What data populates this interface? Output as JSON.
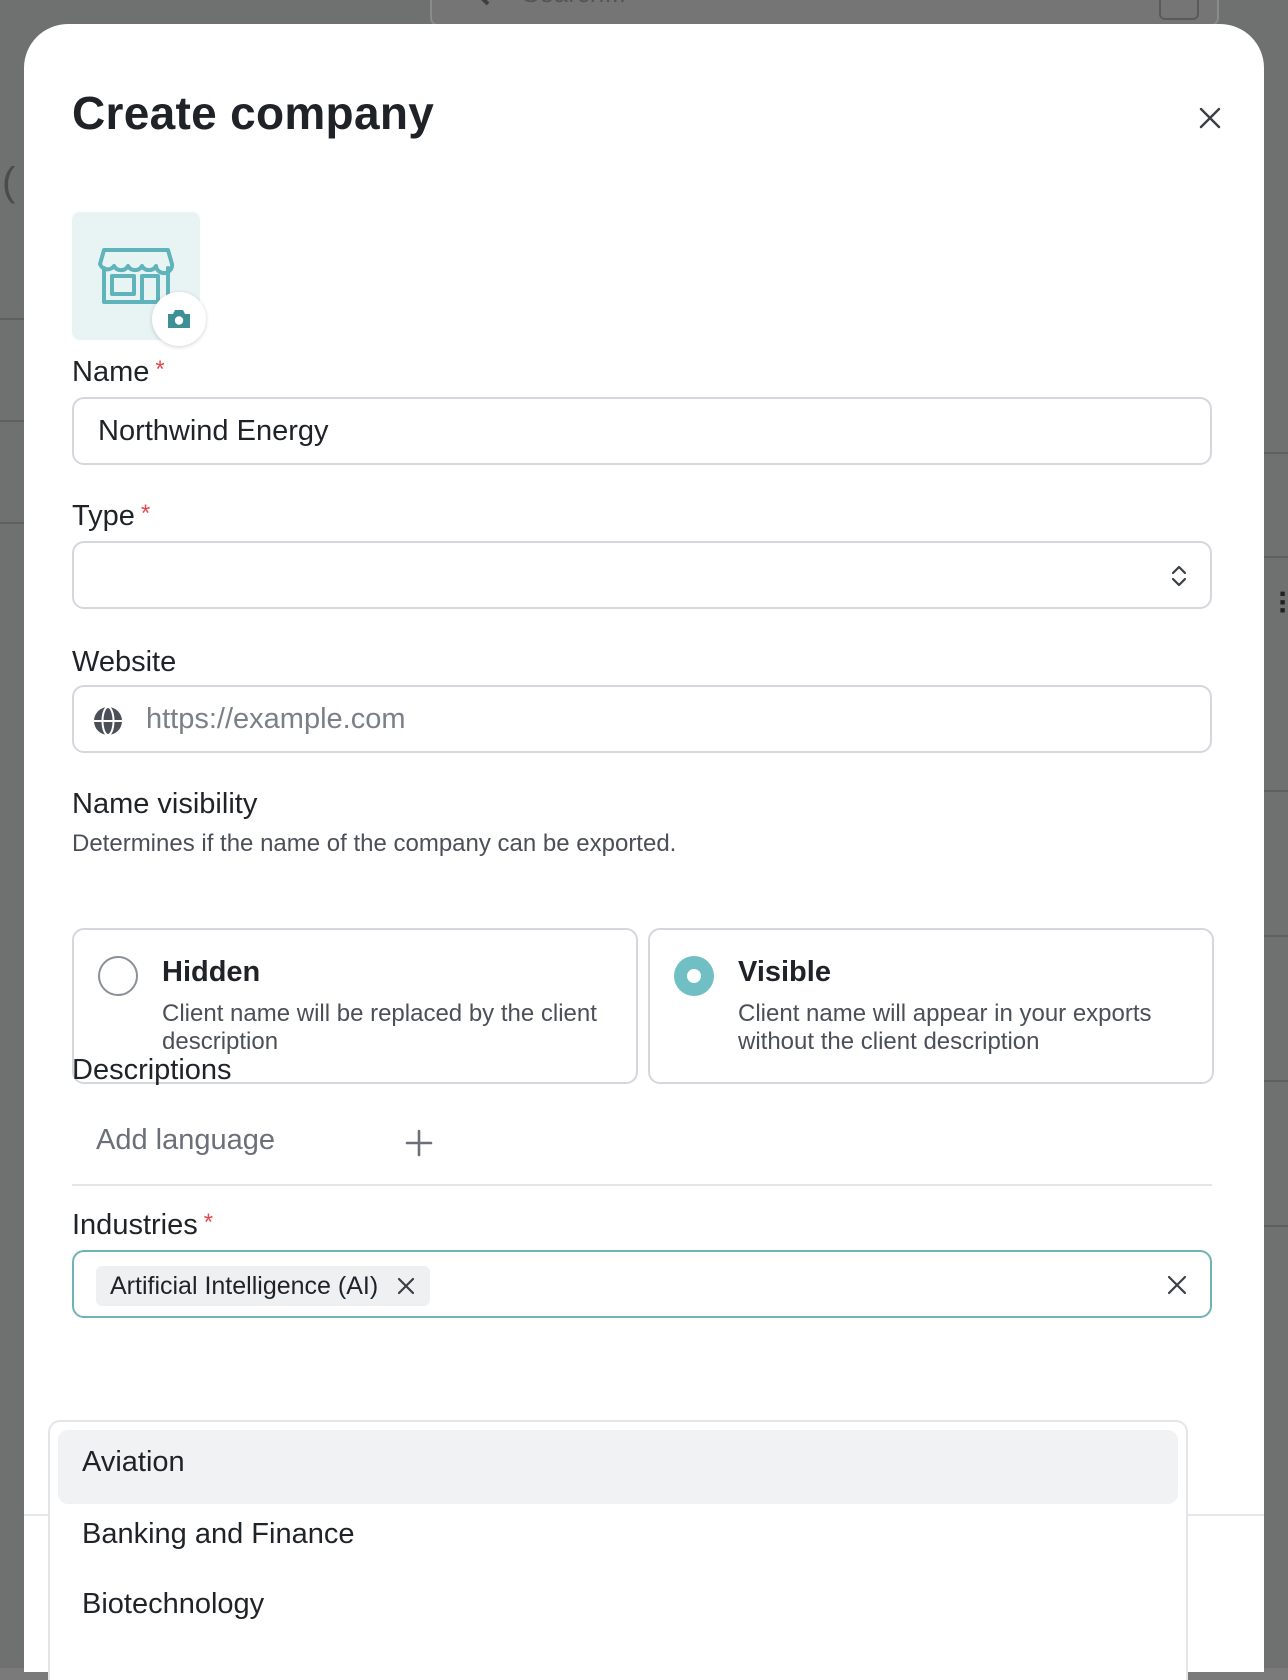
{
  "background": {
    "search_placeholder": "Search..."
  },
  "modal": {
    "title": "Create company"
  },
  "form": {
    "name": {
      "label": "Name",
      "required_mark": "*",
      "value": "Northwind Energy"
    },
    "type": {
      "label": "Type",
      "required_mark": "*",
      "value": ""
    },
    "website": {
      "label": "Website",
      "placeholder": "https://example.com"
    },
    "name_visibility": {
      "label": "Name visibility",
      "help": "Determines if the name of the company can be exported.",
      "options": [
        {
          "title": "Hidden",
          "description": "Client name will be replaced by the client description",
          "selected": false
        },
        {
          "title": "Visible",
          "description": "Client name will appear in your exports without the client description",
          "selected": true
        }
      ]
    },
    "descriptions": {
      "label": "Descriptions",
      "add_language": "Add language"
    },
    "industries": {
      "label": "Industries",
      "required_mark": "*",
      "selected": [
        "Artificial Intelligence (AI)"
      ],
      "options": [
        "Aviation",
        "Banking and Finance",
        "Biotechnology"
      ],
      "highlighted": "Aviation"
    }
  },
  "colors": {
    "accent": "#6fbfc4",
    "required": "#e5484d",
    "logo_bg": "#e8f3f4",
    "primary_button": "#e8621b"
  },
  "icons": {
    "close": "close-icon",
    "logo": "storefront-icon",
    "upload": "camera-icon",
    "select": "chevron-updown-icon",
    "website": "globe-icon",
    "add": "plus-icon"
  }
}
